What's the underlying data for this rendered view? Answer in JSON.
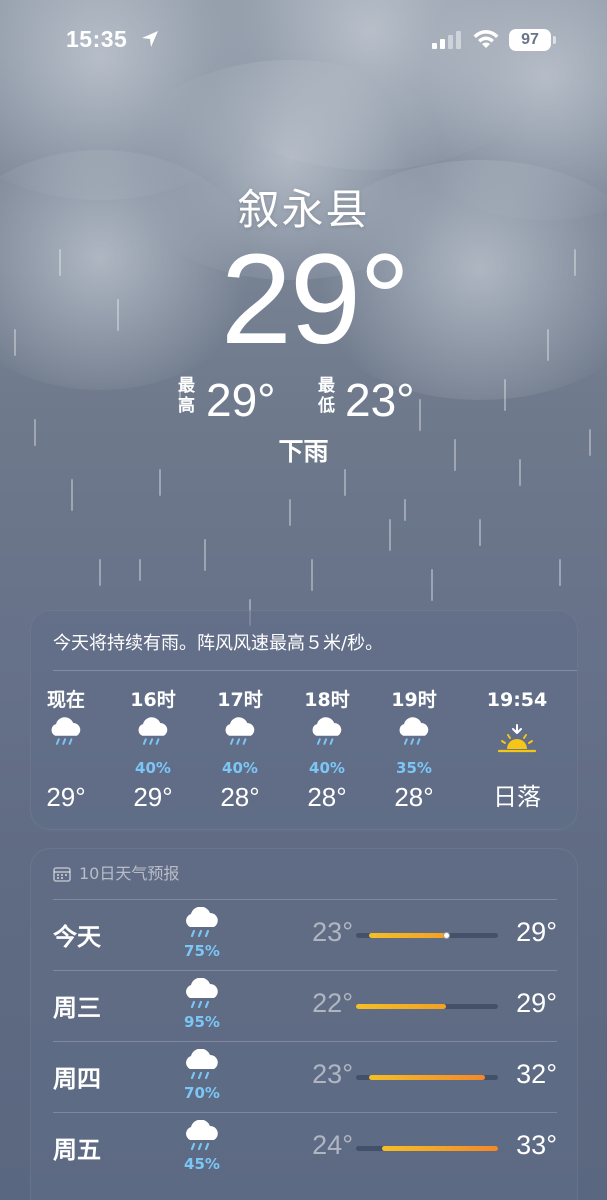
{
  "status_bar": {
    "time": "15:35",
    "battery": "97"
  },
  "hero": {
    "city": "叙永县",
    "temperature": "29°",
    "high_tag": "最高",
    "high": "29°",
    "low_tag": "最低",
    "low": "23°",
    "condition": "下雨"
  },
  "hourly": {
    "summary": "今天将持续有雨。阵风风速最高５米/秒。",
    "items": [
      {
        "label": "现在",
        "icon": "rain-cloud-icon",
        "pct": "",
        "temp": "29°"
      },
      {
        "label": "16时",
        "icon": "rain-cloud-icon",
        "pct": "40%",
        "temp": "29°"
      },
      {
        "label": "17时",
        "icon": "rain-cloud-icon",
        "pct": "40%",
        "temp": "28°"
      },
      {
        "label": "18时",
        "icon": "rain-cloud-icon",
        "pct": "40%",
        "temp": "28°"
      },
      {
        "label": "19时",
        "icon": "rain-cloud-icon",
        "pct": "35%",
        "temp": "28°"
      },
      {
        "label": "19:54",
        "icon": "sunset-icon",
        "pct": "",
        "temp": "日落"
      }
    ]
  },
  "daily": {
    "header": "10日天气预报",
    "range": {
      "min": 22,
      "max": 33
    },
    "days": [
      {
        "name": "今天",
        "icon": "rain-cloud-icon",
        "pct": "75%",
        "low": "23°",
        "high": "29°",
        "low_value": 23,
        "high_value": 29,
        "current_value": 29
      },
      {
        "name": "周三",
        "icon": "rain-cloud-icon",
        "pct": "95%",
        "low": "22°",
        "high": "29°",
        "low_value": 22,
        "high_value": 29
      },
      {
        "name": "周四",
        "icon": "rain-cloud-icon",
        "pct": "70%",
        "low": "23°",
        "high": "32°",
        "low_value": 23,
        "high_value": 32
      },
      {
        "name": "周五",
        "icon": "rain-cloud-icon",
        "pct": "45%",
        "low": "24°",
        "high": "33°",
        "low_value": 24,
        "high_value": 33
      }
    ]
  },
  "colors": {
    "precip_blue": "#7cc6f6",
    "bar_yellow": "#f3c026",
    "bar_orange": "#f3882a"
  }
}
